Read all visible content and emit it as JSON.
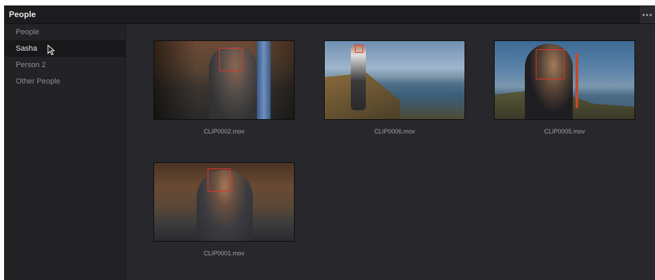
{
  "window": {
    "title": "People",
    "menu_icon": "ellipsis-icon",
    "menu_glyph": "•••"
  },
  "sidebar": {
    "items": [
      {
        "label": "People",
        "selected": false
      },
      {
        "label": "Sasha",
        "selected": true
      },
      {
        "label": "Person 2",
        "selected": false
      },
      {
        "label": "Other People",
        "selected": false
      }
    ]
  },
  "clips": [
    {
      "name": "CLIP0002.mov"
    },
    {
      "name": "CLIP0006.mov"
    },
    {
      "name": "CLIP0005.mov"
    },
    {
      "name": "CLIP0001.mov"
    }
  ],
  "colors": {
    "background": "#28282c",
    "sidebar": "#232326",
    "selected_row": "#18181a",
    "face_box": "#e2332b"
  }
}
